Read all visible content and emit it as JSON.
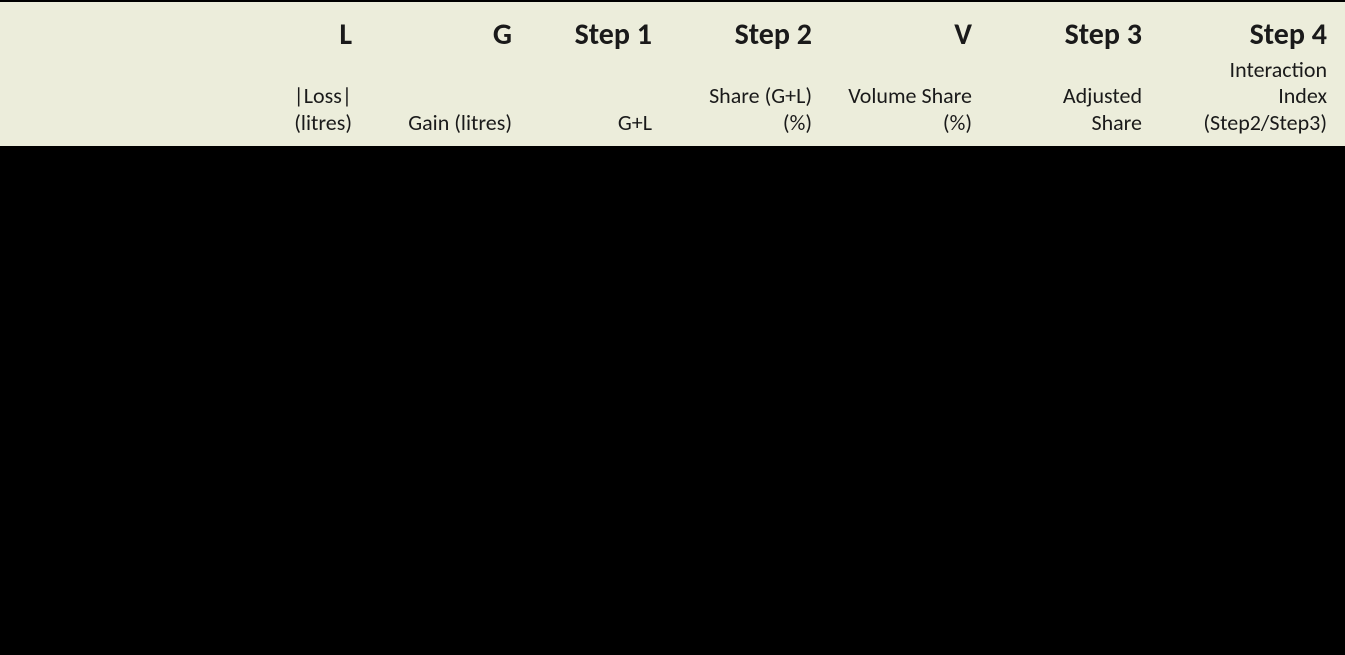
{
  "chart_data": {
    "type": "table",
    "title": "",
    "columns": [
      {
        "key": "label",
        "main": "",
        "sub": ""
      },
      {
        "key": "L",
        "main": "L",
        "sub": "|Loss| (litres)"
      },
      {
        "key": "G",
        "main": "G",
        "sub": "Gain (litres)"
      },
      {
        "key": "step1",
        "main": "Step 1",
        "sub": "G+L"
      },
      {
        "key": "step2",
        "main": "Step 2",
        "sub": "Share (G+L) (%)"
      },
      {
        "key": "V",
        "main": "V",
        "sub": "Volume Share (%)"
      },
      {
        "key": "step3",
        "main": "Step 3",
        "sub": "Adjusted Share"
      },
      {
        "key": "step4",
        "main": "Step 4",
        "sub": "Interaction Index (Step2/Step3)"
      }
    ],
    "rows": []
  }
}
